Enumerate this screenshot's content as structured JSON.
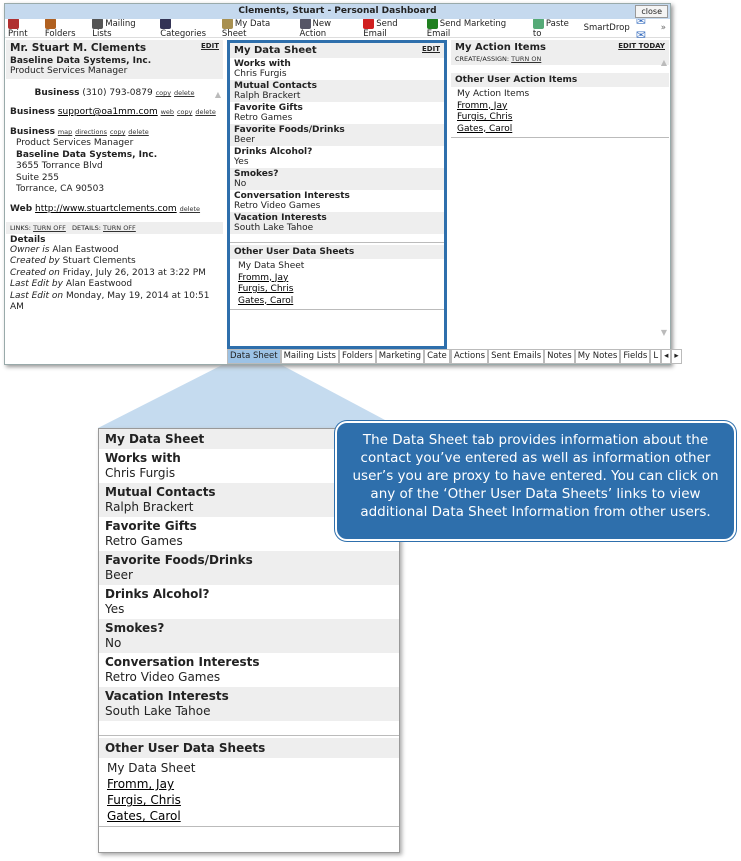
{
  "window": {
    "title": "Clements, Stuart - Personal Dashboard",
    "close": "close"
  },
  "toolbar": [
    {
      "label": "Print",
      "icon": "printer-icon",
      "color": "#b03030"
    },
    {
      "label": "Folders",
      "icon": "folder-icon",
      "color": "#b06020"
    },
    {
      "label": "Mailing Lists",
      "icon": "list-icon",
      "color": "#555"
    },
    {
      "label": "Categories",
      "icon": "categories-icon",
      "color": "#335"
    },
    {
      "label": "My Data Sheet",
      "icon": "data-sheet-icon",
      "color": "#a89050"
    },
    {
      "label": "New Action",
      "icon": "calendar-icon",
      "color": "#556"
    },
    {
      "label": "Send Email",
      "icon": "at-icon",
      "color": "#d02020"
    },
    {
      "label": "Send Marketing Email",
      "icon": "at-green-icon",
      "color": "#208020"
    },
    {
      "label": "Paste to",
      "icon": "clipboard-icon",
      "color": "#5a7"
    },
    {
      "label": "SmartDrop",
      "icon": "",
      "color": ""
    }
  ],
  "contact": {
    "name": "Mr. Stuart M. Clements",
    "edit": "EDIT",
    "company": "Baseline Data Systems, Inc.",
    "title": "Product Services Manager",
    "phone_label": "Business",
    "phone": "(310) 793-0879",
    "copy": "copy",
    "delete": "delete",
    "email_label": "Business",
    "email": "support@oa1mm.com",
    "web": "web",
    "addr_label": "Business",
    "map": "map",
    "directions": "directions",
    "addr": [
      "Product Services Manager",
      "Baseline Data Systems, Inc.",
      "3655 Torrance Blvd",
      "Suite 255",
      "Torrance, CA 90503"
    ],
    "web_label": "Web",
    "url": "http://www.stuartclements.com",
    "links": "LINKS:",
    "details_t": "DETAILS:",
    "turn_off": "TURN OFF",
    "details": "Details",
    "meta": [
      [
        "Owner is",
        "Alan Eastwood"
      ],
      [
        "Created by",
        "Stuart Clements"
      ],
      [
        "Created on",
        "Friday, July 26, 2013 at 3:22 PM"
      ],
      [
        "Last Edit by",
        "Alan Eastwood"
      ],
      [
        "Last Edit on",
        "Monday, May 19, 2014 at 10:51 AM"
      ]
    ]
  },
  "datasheet": {
    "title": "My Data Sheet",
    "edit": "EDIT",
    "items": [
      [
        "Works with",
        "Chris Furgis"
      ],
      [
        "Mutual Contacts",
        "Ralph Brackert"
      ],
      [
        "Favorite Gifts",
        "Retro Games"
      ],
      [
        "Favorite Foods/Drinks",
        "Beer"
      ],
      [
        "Drinks Alcohol?",
        "Yes"
      ],
      [
        "Smokes?",
        "No"
      ],
      [
        "Conversation Interests",
        "Retro Video Games"
      ],
      [
        "Vacation Interests",
        "South Lake Tahoe"
      ]
    ],
    "other_title": "Other User Data Sheets",
    "other": [
      "My Data Sheet",
      "Fromm, Jay",
      "Furgis, Chris",
      "Gates, Carol"
    ]
  },
  "actions": {
    "title": "My Action Items",
    "edit": "EDIT TODAY",
    "create": "CREATE/ASSIGN:",
    "turn_on": "TURN ON",
    "other_title": "Other User Action Items",
    "other": [
      "My Action Items",
      "Fromm, Jay",
      "Furgis, Chris",
      "Gates, Carol"
    ]
  },
  "tabs_mid": [
    "Data Sheet",
    "Mailing Lists",
    "Folders",
    "Marketing",
    "Cate"
  ],
  "tabs_right": [
    "Actions",
    "Sent Emails",
    "Notes",
    "My Notes",
    "Fields",
    "L"
  ],
  "callout": "The Data Sheet tab provides information about the contact you’ve entered as well as information other user’s you are proxy to have entered.  You can click on any of the ‘Other User Data Sheets’ links to view additional Data Sheet Information from other users.",
  "colors": {
    "accent": "#2e6fac",
    "tab_active": "#9cc2e5"
  }
}
